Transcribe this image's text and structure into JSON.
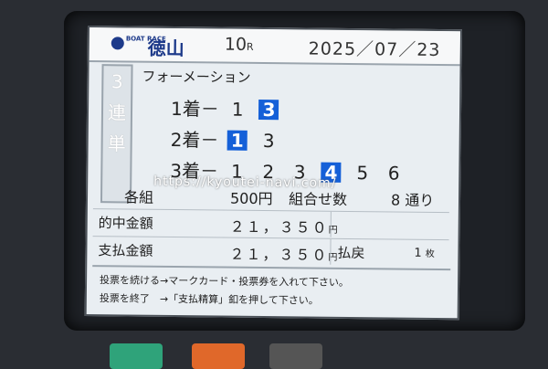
{
  "header": {
    "logo_small": "BOAT RACE",
    "logo_name": "徳山",
    "race_number": "10",
    "race_unit": "R",
    "date": "2025／07／23"
  },
  "bet_type_vertical": [
    "3",
    "連",
    "単"
  ],
  "formation": {
    "title": "フォーメーション",
    "first": {
      "label": "1着－",
      "numbers": [
        "1",
        "3"
      ],
      "selected": [
        "3"
      ]
    },
    "second": {
      "label": "2着－",
      "numbers": [
        "1",
        "3"
      ],
      "selected": [
        "1"
      ]
    },
    "third": {
      "label": "3着－",
      "numbers": [
        "1",
        "2",
        "3",
        "4",
        "5",
        "6"
      ],
      "selected": [
        "4"
      ]
    }
  },
  "watermark": "https://kyoutei-navi.com/",
  "summary": {
    "unit_label": "各組",
    "amount": "500円",
    "combos_label": "組合せ数",
    "combos_value": "8 通り"
  },
  "payout": {
    "hit_label": "的中金額",
    "hit_value": "２１，３５０",
    "hit_unit": "円",
    "pay_label": "支払金額",
    "pay_value": "２１，３５０",
    "pay_unit": "円",
    "refund_label": "払戻",
    "refund_count": "1",
    "refund_unit": "枚"
  },
  "messages": {
    "line1": "投票を続ける→マークカード・投票券を入れて下さい。",
    "line2": "投票を終了　→「支払精算」釦を押して下さい。"
  },
  "colors": {
    "selected": "#1560d8",
    "logo": "#1d3a8a"
  }
}
